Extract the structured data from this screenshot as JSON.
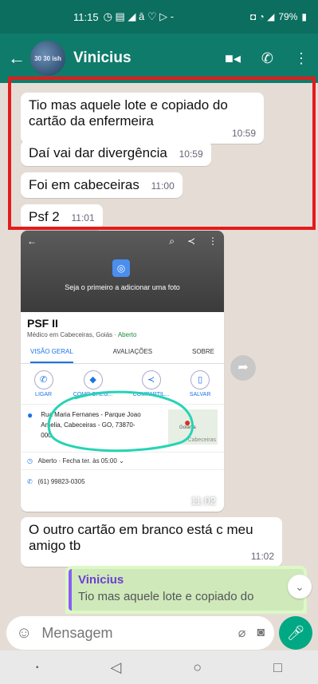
{
  "status_bar": {
    "time": "11:15",
    "icons_left": "◷ ▤ ◢ ā ♡ ▷ -",
    "icons_right": "◘ ◔ ◢",
    "battery": "79%"
  },
  "header": {
    "back_icon": "←",
    "avatar_text": "30 30 ish",
    "contact_name": "Vinicius",
    "video_icon": "■◂",
    "call_icon": "✆",
    "menu_icon": "⋮"
  },
  "messages": [
    {
      "text": "Tio mas aquele lote e copiado do cartão da enfermeira",
      "time": "10:59"
    },
    {
      "text": "Daí vai dar divergência",
      "time": "10:59"
    },
    {
      "text": "Foi em cabeceiras",
      "time": "11:00"
    },
    {
      "text": "Psf 2",
      "time": "11:01"
    }
  ],
  "place_card": {
    "photo_hint": "Seja o primeiro a adicionar uma foto",
    "name": "PSF II",
    "subtitle": "Médico em Cabeceiras, Goiás",
    "status": "Aberto",
    "tabs": [
      "VISÃO GERAL",
      "AVALIAÇÕES",
      "SOBRE"
    ],
    "actions": [
      "LIGAR",
      "COMO CHEG...",
      "COMPARTIL...",
      "SALVAR"
    ],
    "address": "Rua Maria Fernanes - Parque Joao Amelia, Cabeceiras - GO, 73870-000",
    "map_label": "Cabeceiras",
    "map_street": "Goiânia",
    "hours": "Aberto · Fecha ter. às 05:00",
    "phone": "(61) 99823-0305",
    "time": "11:02"
  },
  "message_after": {
    "text": "O outro cartão em branco está c meu amigo tb",
    "time": "11:02"
  },
  "reply_preview": {
    "author": "Vinicius",
    "quote": "Tio mas aquele lote e copiado do"
  },
  "composer": {
    "placeholder": "Mensagem"
  }
}
